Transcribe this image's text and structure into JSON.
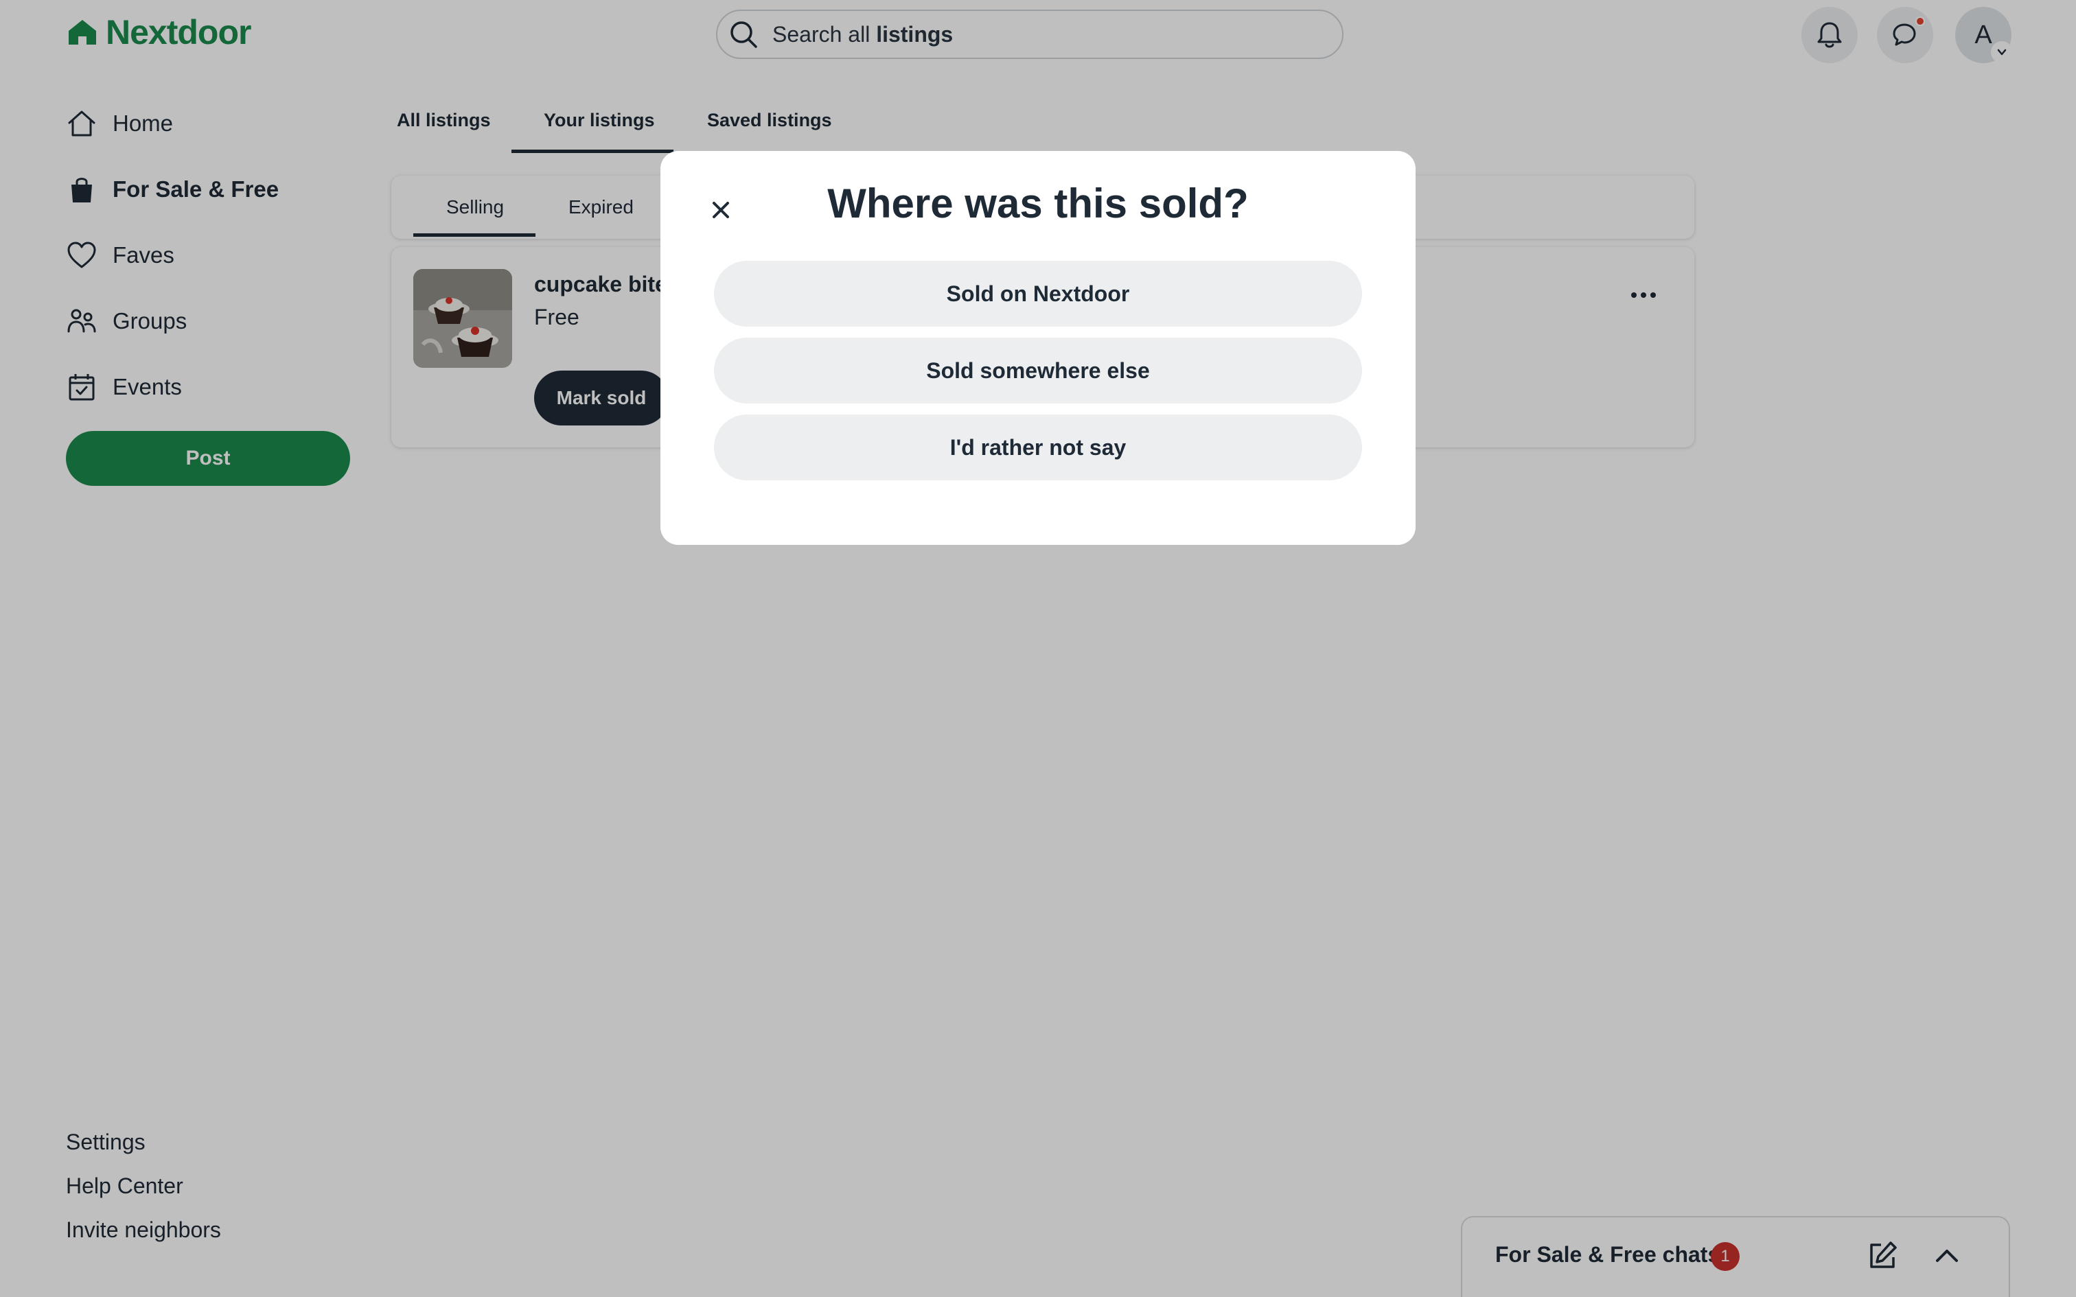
{
  "brand": {
    "name": "Nextdoor",
    "color": "#1b8a4b"
  },
  "header": {
    "search": {
      "prefix": "Search all ",
      "bold": "listings"
    },
    "notifications_icon": "bell-icon",
    "messages_icon": "chat-bubbles-icon",
    "avatar_initial": "A"
  },
  "sidebar": {
    "items": [
      {
        "label": "Home",
        "icon": "house-icon"
      },
      {
        "label": "For Sale & Free",
        "icon": "shopping-bag-icon",
        "active": true
      },
      {
        "label": "Faves",
        "icon": "heart-icon"
      },
      {
        "label": "Groups",
        "icon": "people-icon"
      },
      {
        "label": "Events",
        "icon": "calendar-icon"
      }
    ],
    "post_label": "Post",
    "footer_links": [
      "Settings",
      "Help Center",
      "Invite neighbors"
    ]
  },
  "main": {
    "tabs": [
      {
        "label": "All listings"
      },
      {
        "label": "Your listings",
        "active": true
      },
      {
        "label": "Saved listings"
      }
    ],
    "subtabs": [
      {
        "label": "Selling",
        "active": true
      },
      {
        "label": "Expired"
      }
    ],
    "listing": {
      "title": "cupcake bite",
      "price": "Free",
      "action_label": "Mark sold"
    }
  },
  "modal": {
    "title": "Where was this sold?",
    "options": [
      "Sold on Nextdoor",
      "Sold somewhere else",
      "I'd rather not say"
    ]
  },
  "chat_dock": {
    "title": "For Sale & Free chats",
    "unread_count": "1"
  },
  "colors": {
    "accent_green": "#1b8a4b",
    "dark_text": "#1f2a37",
    "badge_red": "#c9302c"
  }
}
